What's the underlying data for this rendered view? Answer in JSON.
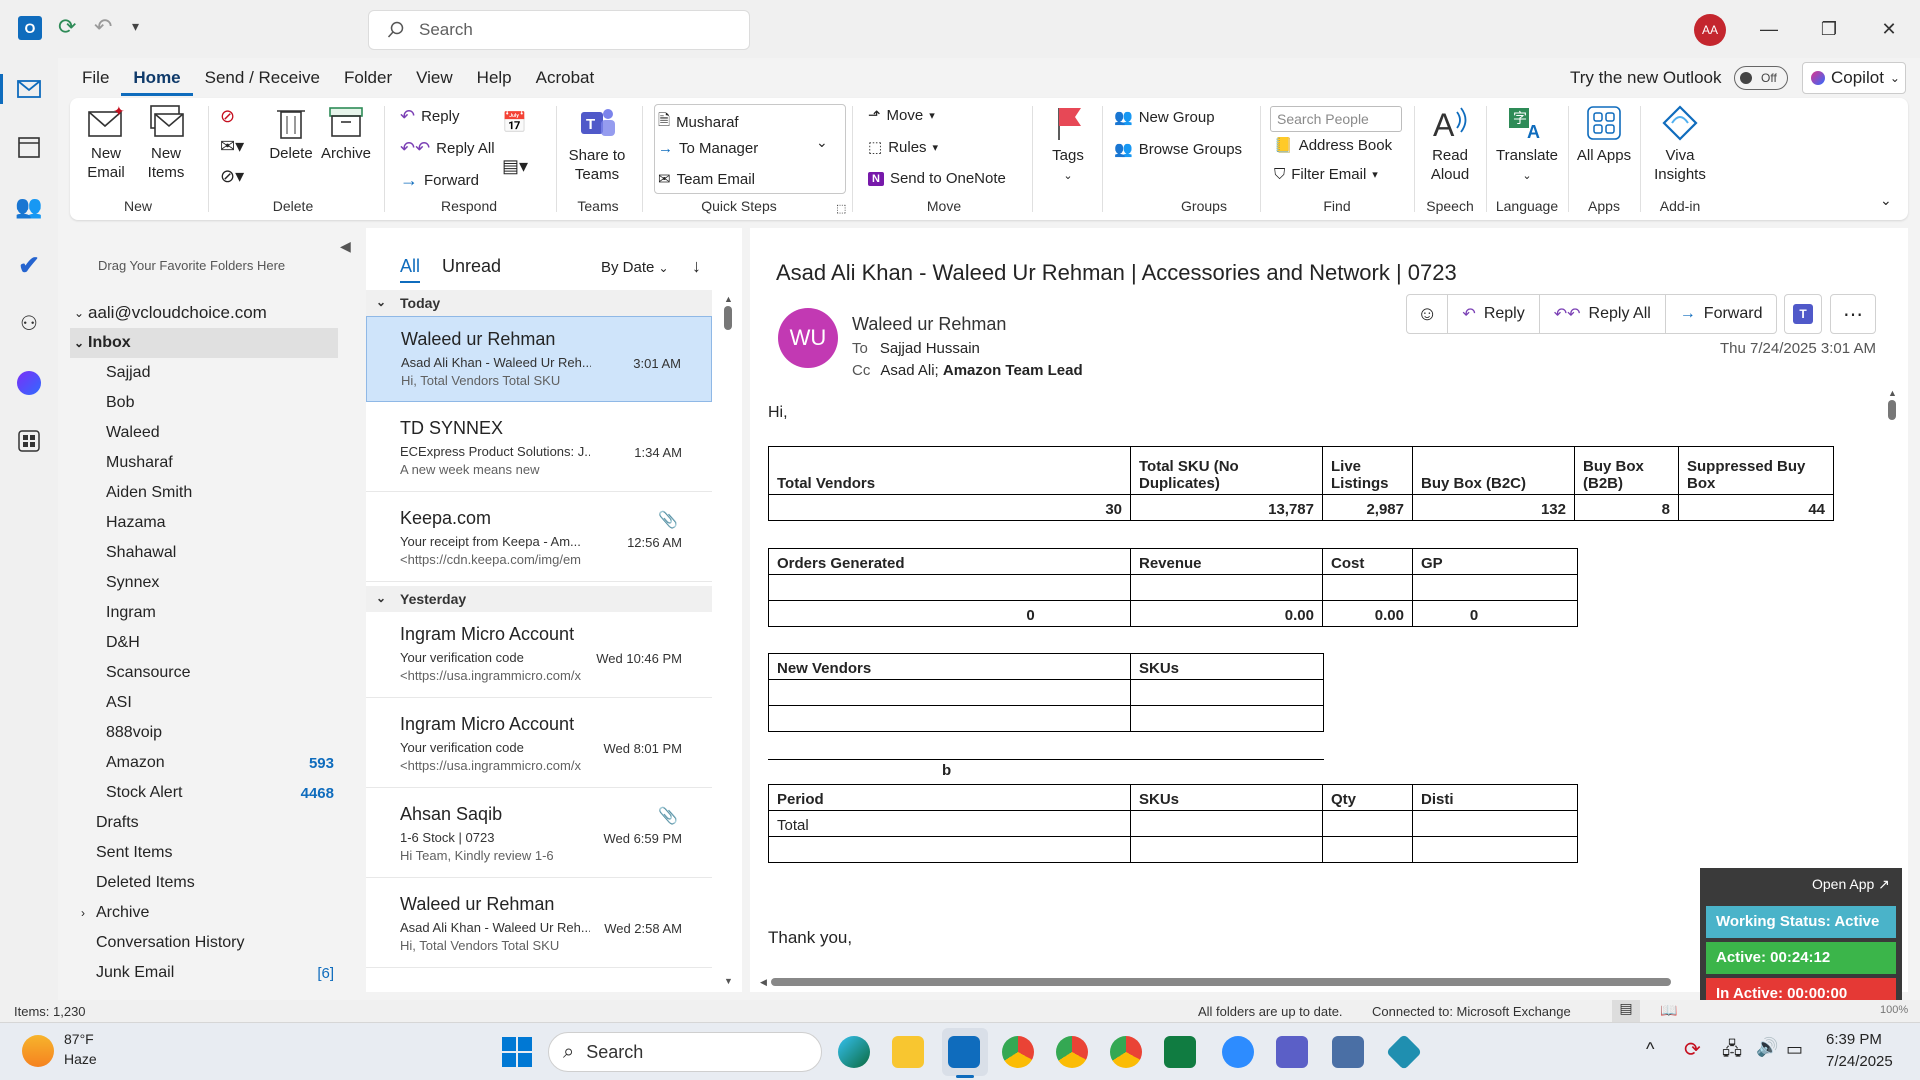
{
  "titlebar": {
    "search_placeholder": "Search",
    "avatar": "AA",
    "try_new": "Try the new Outlook",
    "toggle": "Off",
    "copilot": "Copilot"
  },
  "menu": [
    "File",
    "Home",
    "Send / Receive",
    "Folder",
    "View",
    "Help",
    "Acrobat"
  ],
  "ribbon": {
    "new_email": "New Email",
    "new_items": "New Items",
    "delete": "Delete",
    "archive": "Archive",
    "reply": "Reply",
    "reply_all": "Reply All",
    "forward": "Forward",
    "share_teams": "Share to Teams",
    "qs_musharaf": "Musharaf",
    "qs_manager": "To Manager",
    "qs_team": "Team Email",
    "move": "Move",
    "rules": "Rules",
    "onenote": "Send to OneNote",
    "tags": "Tags",
    "new_group": "New Group",
    "browse_groups": "Browse Groups",
    "search_people": "Search People",
    "address_book": "Address Book",
    "filter_email": "Filter Email",
    "read_aloud": "Read Aloud",
    "translate": "Translate",
    "all_apps": "All Apps",
    "viva": "Viva Insights",
    "groups": [
      "New",
      "Delete",
      "Respond",
      "Teams",
      "Quick Steps",
      "Move",
      "Groups",
      "Find",
      "Speech",
      "Language",
      "Apps",
      "Add-in"
    ]
  },
  "folders": {
    "drag_hint": "Drag Your Favorite Folders Here",
    "account": "aali@vcloudchoice.com",
    "inbox": "Inbox",
    "sub": [
      {
        "name": "Sajjad"
      },
      {
        "name": "Bob"
      },
      {
        "name": "Waleed"
      },
      {
        "name": "Musharaf"
      },
      {
        "name": "Aiden Smith"
      },
      {
        "name": "Hazama"
      },
      {
        "name": "Shahawal"
      },
      {
        "name": "Synnex"
      },
      {
        "name": "Ingram"
      },
      {
        "name": "D&H"
      },
      {
        "name": "Scansource"
      },
      {
        "name": "ASI"
      },
      {
        "name": "888voip"
      },
      {
        "name": "Amazon",
        "count": "593"
      },
      {
        "name": "Stock Alert",
        "count": "4468"
      }
    ],
    "top": [
      {
        "name": "Drafts"
      },
      {
        "name": "Sent Items"
      },
      {
        "name": "Deleted Items"
      },
      {
        "name": "Archive"
      },
      {
        "name": "Conversation History"
      },
      {
        "name": "Junk Email",
        "count": "[6]"
      }
    ]
  },
  "list": {
    "tab_all": "All",
    "tab_unread": "Unread",
    "sort": "By Date",
    "today": "Today",
    "yesterday": "Yesterday",
    "messages": [
      {
        "from": "Waleed ur Rehman",
        "subject": "Asad Ali Khan - Waleed Ur Reh...",
        "preview": "Hi,  Total Vendors  Total SKU",
        "time": "3:01 AM"
      },
      {
        "from": "TD SYNNEX",
        "subject": "ECExpress Product Solutions: J...",
        "preview": "A new week means new",
        "time": "1:34 AM"
      },
      {
        "from": "Keepa.com",
        "subject": "Your receipt from Keepa - Am...",
        "preview": "<https://cdn.keepa.com/img/em",
        "time": "12:56 AM"
      },
      {
        "from": "Ingram Micro Account",
        "subject": "Your verification code",
        "preview": "<https://usa.ingrammicro.com/x",
        "time": "Wed 10:46 PM"
      },
      {
        "from": "Ingram Micro Account",
        "subject": "Your verification code",
        "preview": "<https://usa.ingrammicro.com/x",
        "time": "Wed 8:01 PM"
      },
      {
        "from": "Ahsan Saqib",
        "subject": "1-6 Stock | 0723",
        "preview": "Hi Team,  Kindly review 1-6",
        "time": "Wed 6:59 PM"
      },
      {
        "from": "Waleed ur Rehman",
        "subject": "Asad Ali Khan - Waleed Ur Reh...",
        "preview": "Hi,  Total Vendors  Total SKU",
        "time": "Wed 2:58 AM"
      }
    ]
  },
  "reading": {
    "subject": "Asad Ali Khan - Waleed Ur Rehman | Accessories and Network | 0723",
    "initials": "WU",
    "sender": "Waleed ur Rehman",
    "to_label": "To",
    "to": "Sajjad Hussain",
    "cc_label": "Cc",
    "cc": "Asad Ali; ",
    "cc_bold": "Amazon Team Lead",
    "date": "Thu 7/24/2025 3:01 AM",
    "reply": "Reply",
    "reply_all": "Reply All",
    "forward": "Forward",
    "greeting": "Hi,",
    "thanks": "Thank you,",
    "t1": {
      "headers": [
        "Total Vendors",
        "Total SKU (No Duplicates)",
        "Live Listings",
        "Buy Box (B2C)",
        "Buy Box (B2B)",
        "Suppressed Buy Box"
      ],
      "values": [
        "30",
        "13,787",
        "2,987",
        "132",
        "8",
        "44"
      ]
    },
    "t2": {
      "headers": [
        "Orders Generated",
        "Revenue",
        "Cost",
        "GP"
      ],
      "values": [
        "0",
        "0.00",
        "0.00",
        "0"
      ]
    },
    "t3": {
      "headers": [
        "New Vendors",
        "SKUs"
      ]
    },
    "t4": {
      "title": "b",
      "headers": [
        "Period",
        "SKUs",
        "Qty",
        "Disti"
      ],
      "total": "Total"
    }
  },
  "widget": {
    "open": "Open App ↗",
    "status": "Working Status: Active",
    "active": "Active: 00:24:12",
    "inactive": "In Active: 00:00:00"
  },
  "status": {
    "items": "Items: 1,230",
    "sync": "All folders are up to date.",
    "conn": "Connected to: Microsoft Exchange",
    "zoom": "100%"
  },
  "taskbar": {
    "temp": "87°F",
    "weather": "Haze",
    "search": "Search",
    "time": "6:39 PM",
    "date": "7/24/2025"
  }
}
